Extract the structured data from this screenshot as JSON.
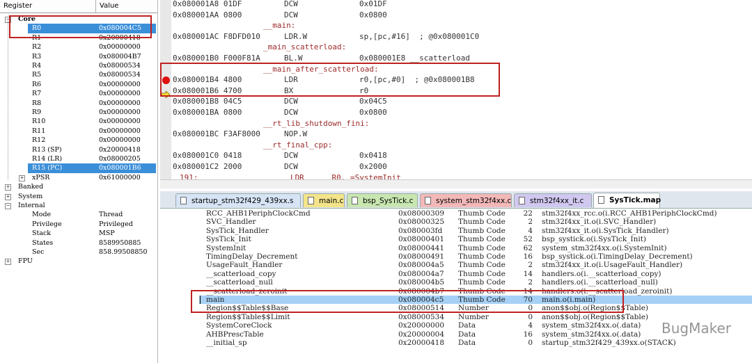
{
  "registers": {
    "header": {
      "col1": "Register",
      "col2": "Value"
    },
    "core_label": "Core",
    "core_regs": [
      {
        "name": "R0",
        "value": "0x080004C5"
      },
      {
        "name": "R1",
        "value": "0x20000418"
      },
      {
        "name": "R2",
        "value": "0x00000000"
      },
      {
        "name": "R3",
        "value": "0x080004B7"
      },
      {
        "name": "R4",
        "value": "0x08000534"
      },
      {
        "name": "R5",
        "value": "0x08000534"
      },
      {
        "name": "R6",
        "value": "0x00000000"
      },
      {
        "name": "R7",
        "value": "0x00000000"
      },
      {
        "name": "R8",
        "value": "0x00000000"
      },
      {
        "name": "R9",
        "value": "0x00000000"
      },
      {
        "name": "R10",
        "value": "0x00000000"
      },
      {
        "name": "R11",
        "value": "0x00000000"
      },
      {
        "name": "R12",
        "value": "0x00000000"
      },
      {
        "name": "R13 (SP)",
        "value": "0x20000418"
      },
      {
        "name": "R14 (LR)",
        "value": "0x08000205"
      },
      {
        "name": "R15 (PC)",
        "value": "0x080001B6"
      },
      {
        "name": "xPSR",
        "value": "0x61000000"
      }
    ],
    "groups": [
      "Banked",
      "System",
      "Internal"
    ],
    "internal": [
      {
        "name": "Mode",
        "value": "Thread"
      },
      {
        "name": "Privilege",
        "value": "Privileged"
      },
      {
        "name": "Stack",
        "value": "MSP"
      },
      {
        "name": "States",
        "value": "8589950885"
      },
      {
        "name": "Sec",
        "value": "858.99508850"
      }
    ],
    "fpu_label": "FPU"
  },
  "disassembly": [
    {
      "kind": "code",
      "addr": "0x080001A8 01DF",
      "op": "DCW",
      "args": "0x01DF"
    },
    {
      "kind": "code",
      "addr": "0x080001AA 0800",
      "op": "DCW",
      "args": "0x0800"
    },
    {
      "kind": "label",
      "text": "__main:"
    },
    {
      "kind": "code",
      "addr": "0x080001AC F8DFD010",
      "op": "LDR.W",
      "args": "sp,[pc,#16]  ; @0x080001C0"
    },
    {
      "kind": "label",
      "text": "_main_scatterload:"
    },
    {
      "kind": "code",
      "addr": "0x080001B0 F000F81A",
      "op": "BL.W",
      "args": "0x080001E8 __scatterload"
    },
    {
      "kind": "label",
      "text": "__main_after_scatterload:"
    },
    {
      "kind": "code",
      "addr": "0x080001B4 4800",
      "op": "LDR",
      "args": "r0,[pc,#0]  ; @0x080001B8",
      "marker": "breakpoint"
    },
    {
      "kind": "code",
      "addr": "0x080001B6 4700",
      "op": "BX",
      "args": "r0",
      "marker": "current"
    },
    {
      "kind": "code",
      "addr": "0x080001B8 04C5",
      "op": "DCW",
      "args": "0x04C5"
    },
    {
      "kind": "code",
      "addr": "0x080001BA 0800",
      "op": "DCW",
      "args": "0x0800"
    },
    {
      "kind": "label",
      "text": "__rt_lib_shutdown_fini:"
    },
    {
      "kind": "code",
      "addr": "0x080001BC F3AF8000",
      "op": "NOP.W",
      "args": ""
    },
    {
      "kind": "label",
      "text": "__rt_final_cpp:"
    },
    {
      "kind": "code",
      "addr": "0x080001C0 0418",
      "op": "DCW",
      "args": "0x0418"
    },
    {
      "kind": "code",
      "addr": "0x080001C2 2000",
      "op": "DCW",
      "args": "0x2000"
    },
    {
      "kind": "src",
      "text": "191:                    LDR      R0, =SystemInit"
    }
  ],
  "tabs": [
    {
      "label": "startup_stm32f429_439xx.s",
      "color": "#d6e4f5",
      "active": false
    },
    {
      "label": "main.c",
      "color": "#f3e48a",
      "active": false
    },
    {
      "label": "bsp_SysTick.c",
      "color": "#c8e6b0",
      "active": false
    },
    {
      "label": "system_stm32f4xx.c",
      "color": "#f3b8b8",
      "active": false
    },
    {
      "label": "stm32f4xx_it.c",
      "color": "#d0c8ef",
      "active": false
    },
    {
      "label": "SysTick.map",
      "color": "#ffffff",
      "active": true
    }
  ],
  "map_rows": [
    {
      "sym": "RCC_AHB1PeriphClockCmd",
      "addr": "0x08000309",
      "type": "Thumb Code",
      "size": "22",
      "obj": "stm32f4xx_rcc.o(i.RCC_AHB1PeriphClockCmd)"
    },
    {
      "sym": "SVC_Handler",
      "addr": "0x08000325",
      "type": "Thumb Code",
      "size": "2",
      "obj": "stm32f4xx_it.o(i.SVC_Handler)"
    },
    {
      "sym": "SysTick_Handler",
      "addr": "0x080003fd",
      "type": "Thumb Code",
      "size": "4",
      "obj": "stm32f4xx_it.o(i.SysTick_Handler)"
    },
    {
      "sym": "SysTick_Init",
      "addr": "0x08000401",
      "type": "Thumb Code",
      "size": "52",
      "obj": "bsp_systick.o(i.SysTick_Init)"
    },
    {
      "sym": "SystemInit",
      "addr": "0x08000441",
      "type": "Thumb Code",
      "size": "62",
      "obj": "system_stm32f4xx.o(i.SystemInit)"
    },
    {
      "sym": "TimingDelay_Decrement",
      "addr": "0x08000491",
      "type": "Thumb Code",
      "size": "16",
      "obj": "bsp_systick.o(i.TimingDelay_Decrement)"
    },
    {
      "sym": "UsageFault_Handler",
      "addr": "0x080004a5",
      "type": "Thumb Code",
      "size": "2",
      "obj": "stm32f4xx_it.o(i.UsageFault_Handler)"
    },
    {
      "sym": "__scatterload_copy",
      "addr": "0x080004a7",
      "type": "Thumb Code",
      "size": "14",
      "obj": "handlers.o(i.__scatterload_copy)"
    },
    {
      "sym": "__scatterload_null",
      "addr": "0x080004b5",
      "type": "Thumb Code",
      "size": "2",
      "obj": "handlers.o(i.__scatterload_null)"
    },
    {
      "sym": "__scatterload_zeroinit",
      "addr": "0x080004b7",
      "type": "Thumb Code",
      "size": "14",
      "obj": "handlers.o(i.__scatterload_zeroinit)"
    },
    {
      "sym": "main",
      "addr": "0x080004c5",
      "type": "Thumb Code",
      "size": "70",
      "obj": "main.o(i.main)",
      "selected": true
    },
    {
      "sym": "Region$$Table$$Base",
      "addr": "0x08000514",
      "type": "Number",
      "size": "0",
      "obj": "anon$$obj.o(Region$$Table)"
    },
    {
      "sym": "Region$$Table$$Limit",
      "addr": "0x08000534",
      "type": "Number",
      "size": "0",
      "obj": "anon$$obj.o(Region$$Table)"
    },
    {
      "sym": "SystemCoreClock",
      "addr": "0x20000000",
      "type": "Data",
      "size": "4",
      "obj": "system_stm32f4xx.o(.data)"
    },
    {
      "sym": "AHBPrescTable",
      "addr": "0x20000004",
      "type": "Data",
      "size": "16",
      "obj": "system_stm32f4xx.o(.data)"
    },
    {
      "sym": "__initial_sp",
      "addr": "0x20000418",
      "type": "Data",
      "size": "0",
      "obj": "startup_stm32f429_439xx.o(STACK)"
    }
  ],
  "watermark": "BugMaker",
  "colors": {
    "highlight": "#c02020",
    "selection": "#3b8fd9",
    "map_selection": "#a6d0f5",
    "label_text": "#9c2a2a"
  }
}
